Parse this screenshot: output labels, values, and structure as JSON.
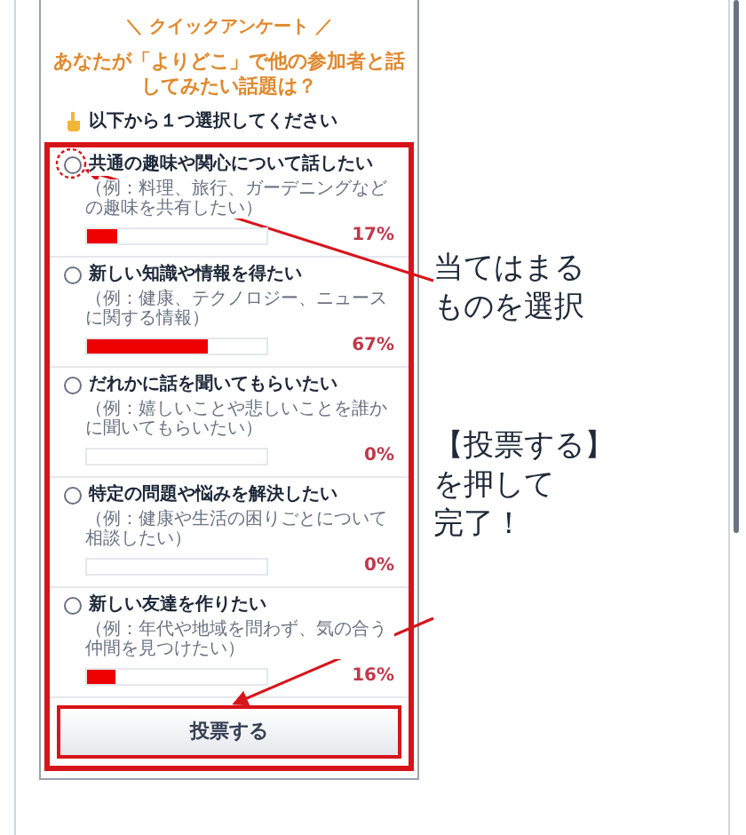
{
  "survey": {
    "heading": "＼ クイックアンケート ／",
    "question": "あなたが「よりどこ」で他の参加者と話してみたい話題は？",
    "instruction": "以下から１つ選択してください",
    "options": [
      {
        "label": "共通の趣味や関心について話したい",
        "example": "（例：料理、旅行、ガーデニングなどの趣味を共有したい）",
        "level": 0.17,
        "percent": "17%",
        "selected": false
      },
      {
        "label": "新しい知識や情報を得たい",
        "example": "（例：健康、テクノロジー、ニュースに関する情報）",
        "level": 0.67,
        "percent": "67%",
        "selected": false
      },
      {
        "label": "だれかに話を聞いてもらいたい",
        "example": "（例：嬉しいことや悲しいことを誰かに聞いてもらいたい）",
        "level": 0,
        "percent": "0%",
        "selected": false
      },
      {
        "label": "特定の問題や悩みを解決したい",
        "example": "（例：健康や生活の困りごとについて相談したい）",
        "level": 0,
        "percent": "0%",
        "selected": false
      },
      {
        "label": "新しい友達を作りたい",
        "example": "（例：年代や地域を問わず、気の合う仲間を見つけたい）",
        "level": 0.16,
        "percent": "16%",
        "selected": false
      }
    ],
    "submit": "投票する"
  },
  "annotations": [
    {
      "lines": [
        "当てはまる",
        "ものを選択"
      ]
    },
    {
      "lines": [
        "【投票する】",
        "を押して",
        "完了！"
      ]
    }
  ]
}
